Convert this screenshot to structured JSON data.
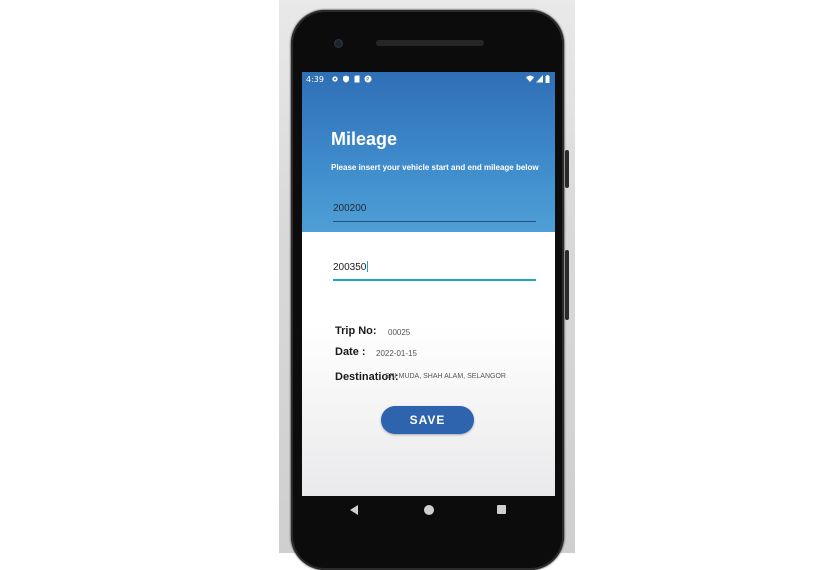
{
  "status_bar": {
    "time": "4:39",
    "left_icons": [
      "gear-icon",
      "shield-icon",
      "sd-card-icon",
      "app-icon"
    ],
    "right_icons": [
      "wifi-icon",
      "signal-icon",
      "battery-icon"
    ]
  },
  "header": {
    "title": "Mileage",
    "subtitle": "Please insert your vehicle start and end mileage below",
    "gradient_top": "#2f6fb5",
    "gradient_bottom": "#4f9fd6"
  },
  "form": {
    "start_mileage": "200200",
    "end_mileage": "200350"
  },
  "details": {
    "trip_label": "Trip No:",
    "trip_value": "00025",
    "date_label": "Date :",
    "date_value": "2022-01-15",
    "destination_label": "Destination:",
    "destination_value": "SRI MUDA, SHAH ALAM, SELANGOR"
  },
  "actions": {
    "save_label": "SAVE",
    "save_color": "#2e63ad",
    "focus_color": "#20a7c0"
  },
  "nav_bar": [
    "back-icon",
    "home-icon",
    "recents-icon"
  ]
}
